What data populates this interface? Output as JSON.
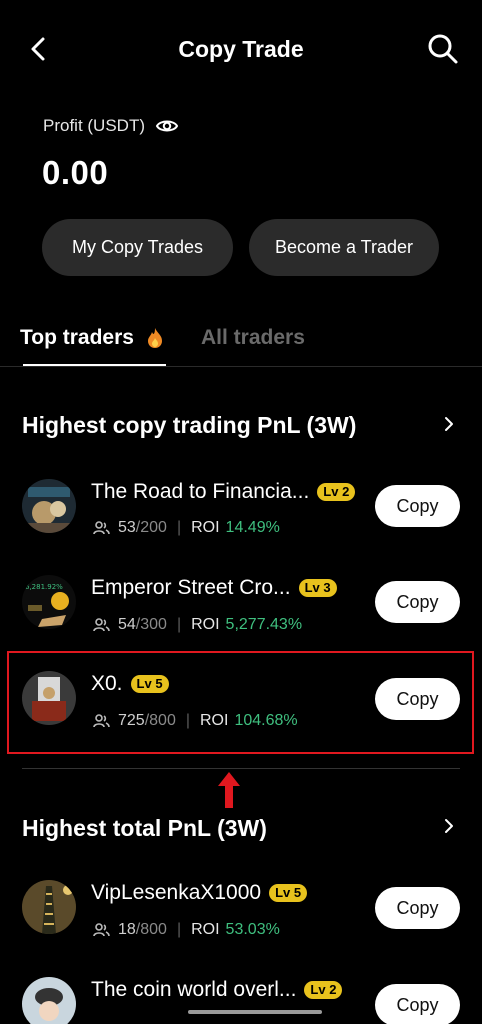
{
  "header": {
    "title": "Copy Trade"
  },
  "profit": {
    "label": "Profit (USDT)",
    "value": "0.00"
  },
  "actions": {
    "my_copy_trades": "My Copy Trades",
    "become_trader": "Become a Trader"
  },
  "tabs": {
    "top": "Top traders",
    "all": "All traders"
  },
  "sections": [
    {
      "title": "Highest copy trading PnL (3W)",
      "traders": [
        {
          "name": "The Road to Financia...",
          "level": "Lv 2",
          "copiers": "53",
          "max": "/200",
          "roi_label": "ROI",
          "roi": "14.49%",
          "button": "Copy"
        },
        {
          "name": "Emperor Street Cro...",
          "level": "Lv 3",
          "copiers": "54",
          "max": "/300",
          "roi_label": "ROI",
          "roi": "5,277.43%",
          "button": "Copy"
        },
        {
          "name": "X0.",
          "level": "Lv 5",
          "copiers": "725",
          "max": "/800",
          "roi_label": "ROI",
          "roi": "104.68%",
          "button": "Copy"
        }
      ]
    },
    {
      "title": "Highest total PnL (3W)",
      "traders": [
        {
          "name": "VipLesenkaX1000",
          "level": "Lv 5",
          "copiers": "18",
          "max": "/800",
          "roi_label": "ROI",
          "roi": "53.03%",
          "button": "Copy"
        },
        {
          "name": "The coin world overl...",
          "level": "Lv 2",
          "copiers": "",
          "max": "",
          "roi_label": "",
          "roi": "",
          "button": "Copy"
        }
      ]
    }
  ],
  "icons": {
    "back": "back-arrow-icon",
    "search": "search-icon",
    "eye": "eye-icon",
    "flame": "flame-icon",
    "users": "users-icon",
    "chevron": "chevron-right-icon",
    "arrow": "red-up-arrow-icon"
  },
  "colors": {
    "background": "#000000",
    "accent_green": "#3fbf7f",
    "level_badge": "#e8c21d",
    "highlight_red": "#e0181f",
    "pill_bg": "#2b2b2b"
  }
}
